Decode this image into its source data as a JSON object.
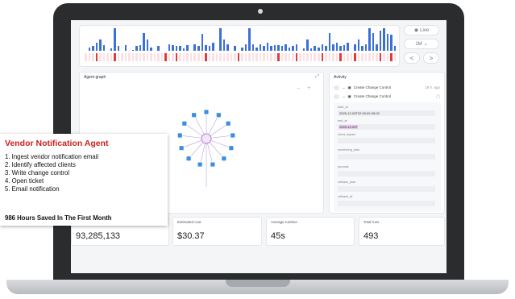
{
  "timeline": {
    "bar_levels": [
      0,
      0.15,
      0.2,
      0.35,
      0.5,
      0.25,
      0,
      0.1,
      1,
      0.2,
      0,
      0.25,
      0,
      0.05,
      0.2,
      0.25,
      0.8,
      0.5,
      0.15,
      0,
      0.2,
      0,
      0,
      0.3,
      0.25,
      0.2,
      0.2,
      0.1,
      0.25,
      0,
      0.3,
      0.2,
      0.75,
      0.25,
      0.2,
      0.35,
      0,
      1,
      0.5,
      0.3,
      0,
      0.2,
      0,
      0.15,
      0.3,
      1,
      0.3,
      0.15,
      0.3,
      0.2,
      0.35,
      0.2,
      0.25,
      0.25,
      0.2,
      0.3,
      0.15,
      0.2,
      0.3,
      0,
      0.1,
      0.5,
      0.1,
      0.2,
      0.15,
      0.3,
      0.2,
      0.8,
      0.3,
      0.35,
      0.2,
      0.25,
      0.35,
      0,
      0.3,
      0.5,
      0.2,
      0.3,
      1,
      0.8,
      0.3,
      0.9,
      1,
      0.75,
      0.7,
      0.2
    ],
    "fail_flags": [
      0,
      0,
      0,
      1,
      0,
      0,
      0,
      0,
      1,
      0,
      0,
      0,
      0,
      0,
      0,
      0,
      0,
      0,
      0,
      0,
      0,
      0,
      1,
      0,
      0,
      1,
      0,
      0,
      0,
      0,
      0,
      0,
      0,
      1,
      0,
      0,
      0,
      0,
      0,
      0,
      0,
      0,
      1,
      0,
      0,
      0,
      0,
      0,
      0,
      0,
      0,
      0,
      0,
      1,
      0,
      0,
      0,
      0,
      1,
      0,
      0,
      0,
      0,
      0,
      0,
      1,
      0,
      0,
      0,
      0,
      1,
      0,
      0,
      0,
      1,
      0,
      0,
      0,
      0,
      0,
      0,
      1,
      0,
      0,
      1,
      0
    ]
  },
  "controls": {
    "live_label": "Live",
    "range_label": "1M",
    "prev_label": "<",
    "next_label": ">"
  },
  "graph": {
    "title": "Agent graph",
    "expand_glyph": "⤢",
    "zoom_controls": "– +"
  },
  "activity": {
    "title": "Activity",
    "rows": [
      {
        "label": "Create Change Control",
        "time": "19 h. ago"
      },
      {
        "label": "Create Change Control",
        "time": ""
      }
    ],
    "fields": [
      {
        "label": "start_at",
        "value": "2025-12-09T22:00:00-05:00"
      },
      {
        "label": "end_at",
        "value": "2025-12-09T"
      },
      {
        "label": "client_impact",
        "value": ""
      },
      {
        "label": "monitoring_plan",
        "value": ""
      },
      {
        "label": "purpose",
        "value": ""
      },
      {
        "label": "rollback_plan",
        "value": ""
      },
      {
        "label": "rollback_at",
        "value": ""
      }
    ]
  },
  "stats": [
    {
      "label": "",
      "value": "93,285,133"
    },
    {
      "label": "Estimated cost",
      "value": "$30.37"
    },
    {
      "label": "Average runtime",
      "value": "45s"
    },
    {
      "label": "Total runs",
      "value": "493"
    }
  ],
  "callout": {
    "title": "Vendor Notification Agent",
    "steps": [
      "1.  Ingest vendor notification email",
      "2.  Identify affected clients",
      "3.  Write change control",
      "4.  Open ticket",
      "5.  Email notification"
    ],
    "footer": "986 Hours Saved In The First Month"
  },
  "colors": {
    "bar_blue": "#3b6fd9",
    "fail_red": "#e03b3b",
    "callout_title": "#cc1f1f",
    "node_blue": "#3b8fe0",
    "hub_purple": "#b87fd0"
  }
}
